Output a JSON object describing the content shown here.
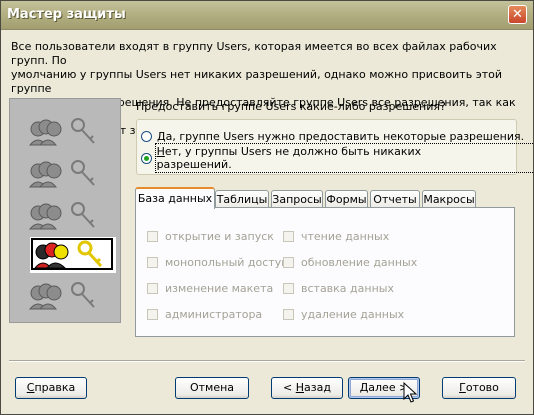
{
  "window": {
    "title": "Мастер защиты",
    "close_glyph": "✕"
  },
  "description": "Все пользователи входят в группу Users, которая имеется во всех файлах рабочих групп. По\nумолчанию у группы Users нет никаких разрешений, однако можно присвоить этой группе\nограниченные разрешения. Не предоставляйте группе Users все разрешения, так как это\nполностью снимает защиту.",
  "question": "Предоставить группе Users какие-либо разрешения?",
  "options": {
    "yes": {
      "accel": "Д",
      "rest": "а, группе Users нужно предоставить некоторые разрешения.",
      "selected": false
    },
    "no": {
      "accel": "Н",
      "rest": "ет, у группы Users не должно быть никаких разрешений.",
      "selected": true
    }
  },
  "tabs": [
    "База данных",
    "Таблицы",
    "Запросы",
    "Формы",
    "Отчеты",
    "Макросы"
  ],
  "active_tab": "База данных",
  "permissions_left": [
    "открытие и запуск",
    "монопольный доступ",
    "изменение макета",
    "администратора"
  ],
  "permissions_right": [
    "чтение данных",
    "обновление данных",
    "вставка данных",
    "удаление данных"
  ],
  "buttons": {
    "help": {
      "accel": "С",
      "rest": "правка"
    },
    "cancel": {
      "label": "Отмена"
    },
    "back": {
      "prefix": "< ",
      "accel": "Н",
      "rest": "азад"
    },
    "next": {
      "accel": "Д",
      "rest": "алее >"
    },
    "done": {
      "accel": "Г",
      "rest": "отово"
    }
  },
  "colors": {
    "title_bar": "#b3b083",
    "tab_accent": "#e68b2c",
    "radio_dot": "#21a121",
    "button_border": "#003c74"
  }
}
